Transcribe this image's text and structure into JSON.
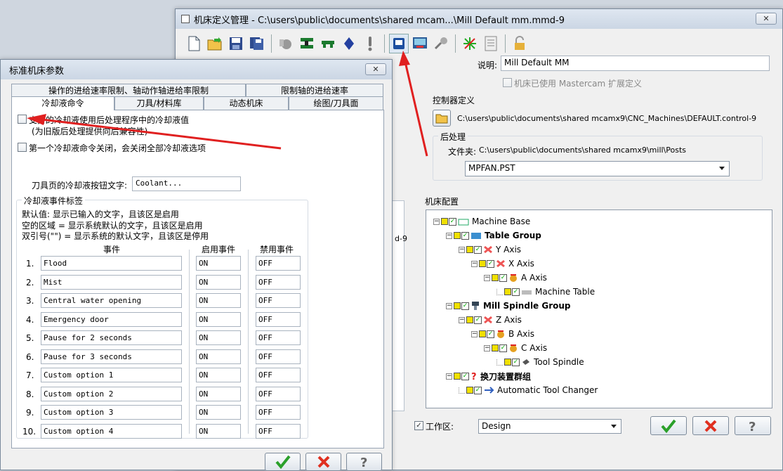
{
  "main_window": {
    "title": "机床定义管理 - C:\\users\\public\\documents\\shared mcam...\\Mill Default mm.mmd-9",
    "close": "✕",
    "description_label": "说明:",
    "description_value": "Mill Default MM",
    "extended_label": "机床已使用 Mastercam 扩展定义",
    "controller_title": "控制器定义",
    "controller_path": "C:\\users\\public\\documents\\shared mcamx9\\CNC_Machines\\DEFAULT.control-9",
    "post_title": "后处理",
    "folder_label": "文件夹:",
    "folder_path": "C:\\users\\public\\documents\\shared mcamx9\\mill\\Posts",
    "post_select": "MPFAN.PST",
    "config_title": "机床配置",
    "tree": [
      {
        "label": "Machine Base",
        "bold": false
      },
      {
        "label": "Table Group",
        "bold": true
      },
      {
        "label": "Y Axis",
        "bold": false
      },
      {
        "label": "X Axis",
        "bold": false
      },
      {
        "label": "A Axis",
        "bold": false
      },
      {
        "label": "Machine Table",
        "bold": false
      },
      {
        "label": "Mill Spindle Group",
        "bold": true
      },
      {
        "label": "Z Axis",
        "bold": false
      },
      {
        "label": "B Axis",
        "bold": false
      },
      {
        "label": "C Axis",
        "bold": false
      },
      {
        "label": "Tool Spindle",
        "bold": false
      },
      {
        "label": "换刀装置群组",
        "bold": true
      },
      {
        "label": "Automatic Tool Changer",
        "bold": false
      }
    ],
    "workarea_label": "工作区:",
    "workarea_select": "Design",
    "partial_text": "d-9"
  },
  "dialog": {
    "title": "标准机床参数",
    "close": "✕",
    "tabs_row1": [
      "操作的进给速率限制、轴动作轴进给率限制",
      "限制轴的进给速率"
    ],
    "tabs_row2": [
      "冷却液命令",
      "刀具/材料库",
      "动态机床",
      "绘图/刀具面"
    ],
    "chk1_label": "支持的冷却液使用后处理程序中的冷却液值",
    "chk1_sub": "(为旧版后处理提供向后兼容性)",
    "chk2_label": "第一个冷却液命令关闭，会关闭全部冷却液选项",
    "button_text_label": "刀具页的冷却液按钮文字:",
    "button_text_value": "Coolant...",
    "events_title": "冷却液事件标签",
    "info_lines": [
      "默认值: 显示已输入的文字，且该区是启用",
      "空的区域 = 显示系统默认的文字，且该区是启用",
      "双引号(\"\") =  显示系统的默认文字，且该区是停用"
    ],
    "col_event": "事件",
    "col_on": "启用事件",
    "col_off": "禁用事件",
    "rows": [
      {
        "num": "1.",
        "event": "Flood",
        "on": "ON",
        "off": "OFF"
      },
      {
        "num": "2.",
        "event": "Mist",
        "on": "ON",
        "off": "OFF"
      },
      {
        "num": "3.",
        "event": "Central water opening",
        "on": "ON",
        "off": "OFF"
      },
      {
        "num": "4.",
        "event": "Emergency door",
        "on": "ON",
        "off": "OFF"
      },
      {
        "num": "5.",
        "event": "Pause for 2 seconds",
        "on": "ON",
        "off": "OFF"
      },
      {
        "num": "6.",
        "event": "Pause for 3 seconds",
        "on": "ON",
        "off": "OFF"
      },
      {
        "num": "7.",
        "event": "Custom option 1",
        "on": "ON",
        "off": "OFF"
      },
      {
        "num": "8.",
        "event": "Custom option 2",
        "on": "ON",
        "off": "OFF"
      },
      {
        "num": "9.",
        "event": "Custom option 3",
        "on": "ON",
        "off": "OFF"
      },
      {
        "num": "10.",
        "event": "Custom option 4",
        "on": "ON",
        "off": "OFF"
      }
    ]
  },
  "colors": {
    "accent": "#e02020",
    "ok_green": "#2aa02a",
    "cancel_red": "#e03020"
  }
}
